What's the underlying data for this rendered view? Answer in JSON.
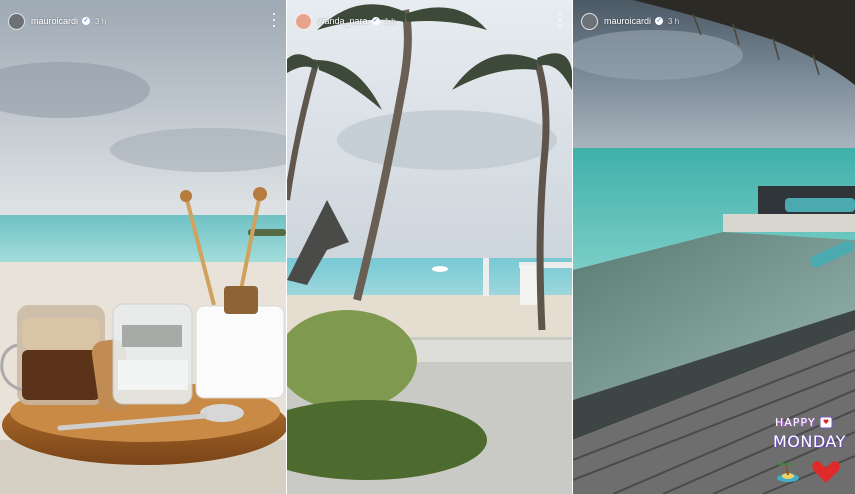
{
  "stories": [
    {
      "username": "mauroicardi",
      "time": "3 h"
    },
    {
      "username": "wanda_nara",
      "time": "1 h"
    },
    {
      "username": "mauroicardi",
      "time": "3 h"
    }
  ],
  "sticker": {
    "line1": "HAPPY",
    "line2": "MONDAY"
  },
  "colors": {
    "sea": "#7fd0d0",
    "sky": "#b9c3cc",
    "sand": "#eae4da",
    "deck": "#6e6e6e",
    "verified": "#3a8ee6",
    "heart": "#e02a2a"
  }
}
